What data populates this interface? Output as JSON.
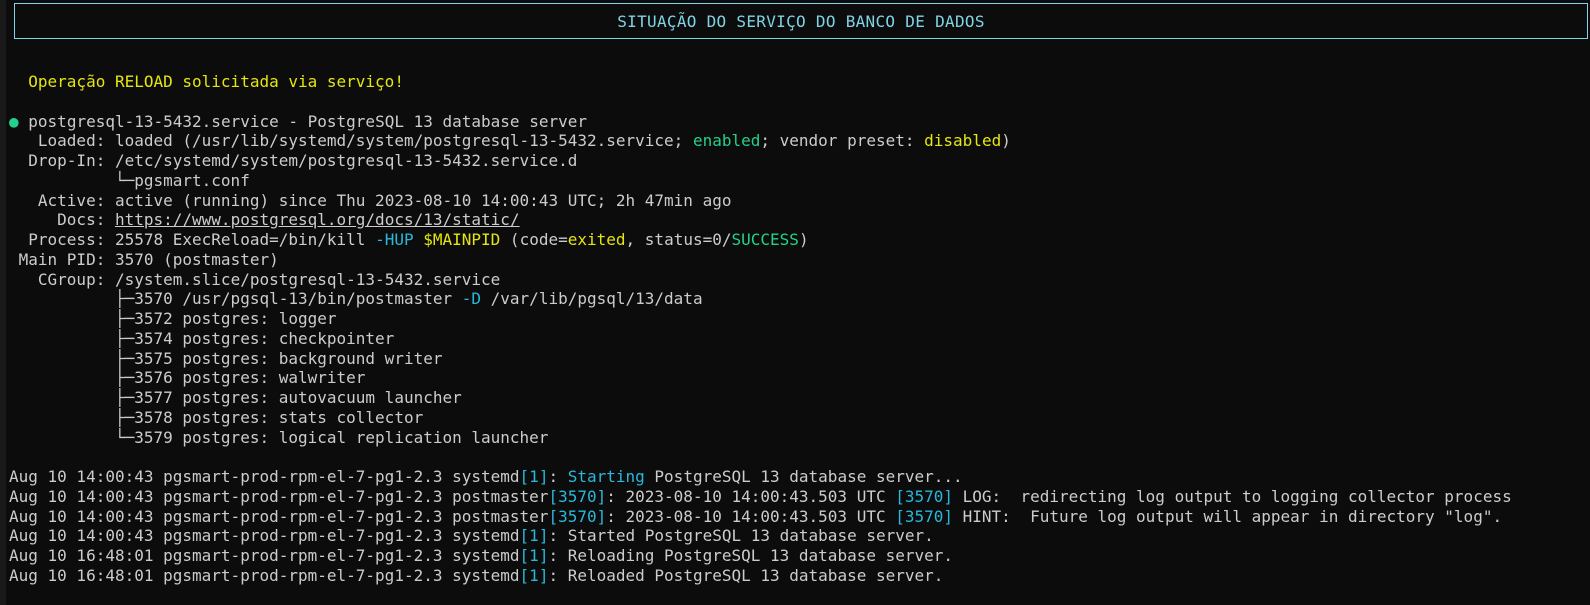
{
  "header": {
    "title": "SITUAÇÃO DO SERVIÇO DO BANCO DE DADOS"
  },
  "message": "  Operação RELOAD solicitada via serviço!",
  "status": {
    "service_line": "postgresql-13-5432.service - PostgreSQL 13 database server",
    "loaded": {
      "label": "   Loaded: ",
      "prefix": "loaded (/usr/lib/systemd/system/postgresql-13-5432.service; ",
      "enabled": "enabled",
      "mid": "; vendor preset: ",
      "preset": "disabled",
      "suffix": ")"
    },
    "dropin": {
      "label": "  Drop-In: ",
      "path": "/etc/systemd/system/postgresql-13-5432.service.d",
      "file": "           └─pgsmart.conf"
    },
    "active": {
      "label": "   Active: ",
      "value": "active (running) since Thu 2023-08-10 14:00:43 UTC; 2h 47min ago"
    },
    "docs": {
      "label": "     Docs: ",
      "url": "https://www.postgresql.org/docs/13/static/"
    },
    "process": {
      "label": "  Process: ",
      "prefix": "25578 ExecReload=/bin/kill ",
      "flag": "-HUP",
      "space": " ",
      "var": "$MAINPID",
      "code_prefix": " (code=",
      "code": "exited",
      "status_prefix": ", status=0/",
      "status": "SUCCESS",
      "suffix": ")"
    },
    "main_pid": {
      "label": " Main PID: ",
      "value": "3570 (postmaster)"
    },
    "cgroup": {
      "label": "   CGroup: ",
      "path": "/system.slice/postgresql-13-5432.service",
      "tree": [
        {
          "prefix": "           ├─3570 /usr/pgsql-13/bin/postmaster ",
          "flag": "-D",
          "suffix": " /var/lib/pgsql/13/data"
        },
        {
          "prefix": "           ├─3572 postgres: logger",
          "flag": "",
          "suffix": ""
        },
        {
          "prefix": "           ├─3574 postgres: checkpointer",
          "flag": "",
          "suffix": ""
        },
        {
          "prefix": "           ├─3575 postgres: background writer",
          "flag": "",
          "suffix": ""
        },
        {
          "prefix": "           ├─3576 postgres: walwriter",
          "flag": "",
          "suffix": ""
        },
        {
          "prefix": "           ├─3577 postgres: autovacuum launcher",
          "flag": "",
          "suffix": ""
        },
        {
          "prefix": "           ├─3578 postgres: stats collector",
          "flag": "",
          "suffix": ""
        },
        {
          "prefix": "           └─3579 postgres: logical replication launcher",
          "flag": "",
          "suffix": ""
        }
      ]
    }
  },
  "logs": [
    {
      "a": "Aug 10 14:00:43 pgsmart-prod-rpm-el-7-pg1-2.3 systemd",
      "b": "[1]",
      "c": ": ",
      "d": "Starting",
      "e": " PostgreSQL 13 database server...",
      "f": "",
      "g": ""
    },
    {
      "a": "Aug 10 14:00:43 pgsmart-prod-rpm-el-7-pg1-2.3 postmaster",
      "b": "[3570]",
      "c": ": 2023-08-10 14:00:43.503 UTC ",
      "d": "[3570]",
      "e": " LOG:  redirecting log output to logging collector process",
      "f": "",
      "g": ""
    },
    {
      "a": "Aug 10 14:00:43 pgsmart-prod-rpm-el-7-pg1-2.3 postmaster",
      "b": "[3570]",
      "c": ": 2023-08-10 14:00:43.503 UTC ",
      "d": "[3570]",
      "e": " HINT:  Future log output will appear in directory \"log\".",
      "f": "",
      "g": ""
    },
    {
      "a": "Aug 10 14:00:43 pgsmart-prod-rpm-el-7-pg1-2.3 systemd",
      "b": "[1]",
      "c": ": Started PostgreSQL 13 database server.",
      "d": "",
      "e": "",
      "f": "",
      "g": ""
    },
    {
      "a": "Aug 10 16:48:01 pgsmart-prod-rpm-el-7-pg1-2.3 systemd",
      "b": "[1]",
      "c": ": Reloading PostgreSQL 13 database server.",
      "d": "",
      "e": "",
      "f": "",
      "g": ""
    },
    {
      "a": "Aug 10 16:48:01 pgsmart-prod-rpm-el-7-pg1-2.3 systemd",
      "b": "[1]",
      "c": ": Reloaded PostgreSQL 13 database server.",
      "d": "",
      "e": "",
      "f": "",
      "g": ""
    }
  ],
  "colors": {
    "accent": "#7fd4e6",
    "yellow": "#e5e510",
    "green": "#23d18b",
    "cyan": "#29b8db"
  }
}
